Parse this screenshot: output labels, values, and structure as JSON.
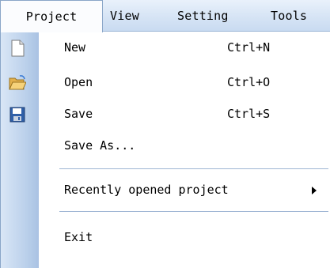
{
  "menubar": {
    "items": [
      {
        "label": "Project",
        "active": true
      },
      {
        "label": "View"
      },
      {
        "label": "Setting"
      },
      {
        "label": "Tools"
      }
    ]
  },
  "project_menu": {
    "new": {
      "label": "New",
      "shortcut": "Ctrl+N",
      "icon": "new-document-icon"
    },
    "open": {
      "label": "Open",
      "shortcut": "Ctrl+O",
      "icon": "open-folder-icon"
    },
    "save": {
      "label": "Save",
      "shortcut": "Ctrl+S",
      "icon": "floppy-disk-icon"
    },
    "saveas": {
      "label": "Save As..."
    },
    "recent": {
      "label": "Recently opened project",
      "has_submenu": true
    },
    "exit": {
      "label": "Exit"
    }
  },
  "colors": {
    "menubar_bg": "#d6e4f5",
    "icon_strip": "#b9cfea",
    "separator": "#9eb5d4"
  }
}
